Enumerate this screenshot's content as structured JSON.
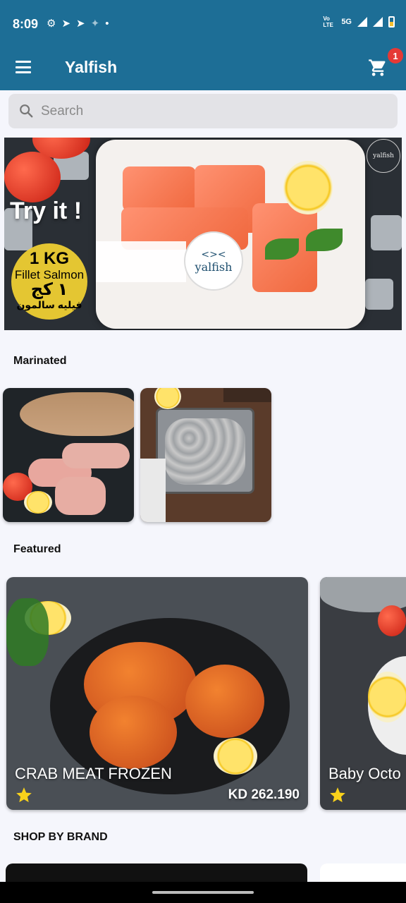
{
  "status_bar": {
    "time": "8:09",
    "network": "5G",
    "lte_label": "Vo LTE"
  },
  "app_bar": {
    "title": "Yalfish",
    "cart_count": "1",
    "brand_color": "#1d6e96"
  },
  "search": {
    "placeholder": "Search"
  },
  "banner": {
    "headline": "Try it !",
    "weight": "1 KG",
    "product": "Fillet Salmon",
    "weight_ar": "١ كج",
    "product_ar": "فيليه سالمون",
    "package_brand": "yalfish",
    "corner_logo": "yalfish"
  },
  "sections": {
    "marinated": "Marinated",
    "featured": "Featured",
    "brands": "SHOP BY BRAND"
  },
  "featured": [
    {
      "name": "CRAB MEAT FROZEN",
      "price": "KD 262.190",
      "rating_icon": "star-icon"
    },
    {
      "name": "Baby Octo",
      "rating_icon": "star-icon"
    }
  ]
}
